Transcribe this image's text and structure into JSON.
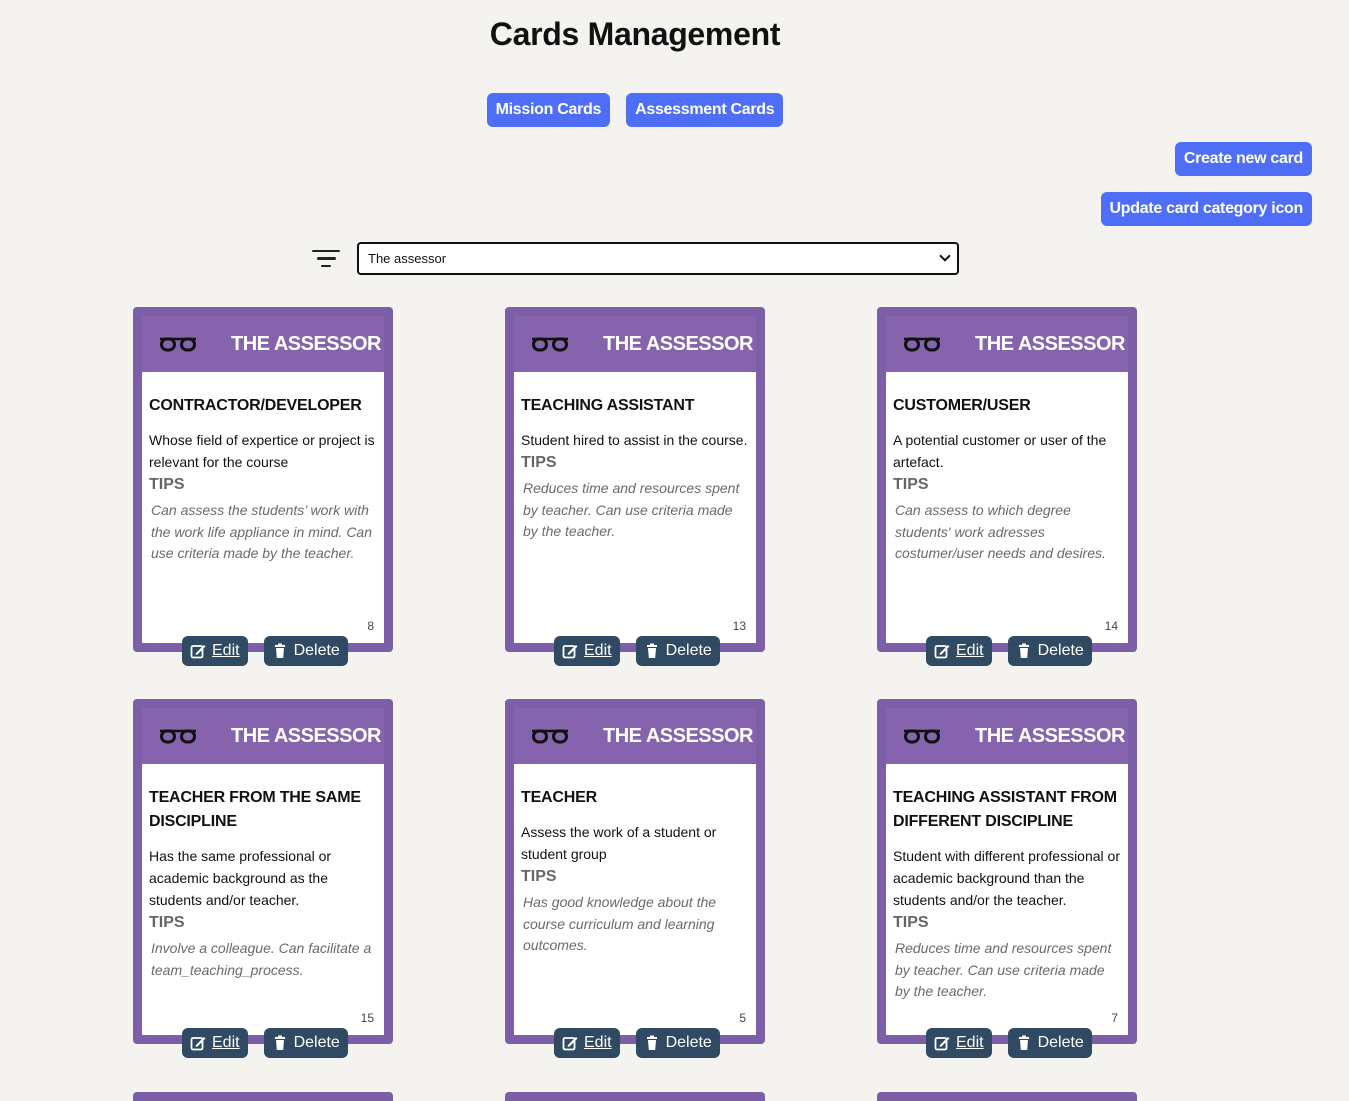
{
  "page": {
    "title": "Cards Management"
  },
  "tabs": [
    {
      "label": "Mission Cards"
    },
    {
      "label": "Assessment Cards"
    }
  ],
  "actions": {
    "create_label": "Create new card",
    "update_label": "Update card category icon"
  },
  "filter": {
    "selected": "The assessor"
  },
  "colors": {
    "accent_blue": "#4f6ef7",
    "card_purple": "#7d5fa8",
    "button_dark": "#2f4a62"
  },
  "cards": [
    {
      "category": "THE ASSESSOR",
      "icon": "glasses-icon",
      "title": "CONTRACTOR/DEVELOPER",
      "description": "Whose field of expertice or project is relevant for the course",
      "tips_label": "TIPS",
      "tips": "Can assess the students’ work with the work life appliance in mind. Can use criteria made by the teacher.",
      "number": "8",
      "edit_label": "Edit",
      "delete_label": "Delete"
    },
    {
      "category": "THE ASSESSOR",
      "icon": "glasses-icon",
      "title": "TEACHING ASSISTANT",
      "description": "Student hired to assist in the course.",
      "tips_label": "TIPS",
      "tips": "Reduces time and resources spent by teacher. Can use criteria made by the teacher.",
      "number": "13",
      "edit_label": "Edit",
      "delete_label": "Delete"
    },
    {
      "category": "THE ASSESSOR",
      "icon": "glasses-icon",
      "title": "CUSTOMER/USER",
      "description": "A potential customer or user of the artefact.",
      "tips_label": "TIPS",
      "tips": "Can assess to which degree students' work adresses costumer/user needs and desires.",
      "number": "14",
      "edit_label": "Edit",
      "delete_label": "Delete"
    },
    {
      "category": "THE ASSESSOR",
      "icon": "glasses-icon",
      "title": "TEACHER FROM THE SAME DISCIPLINE",
      "description": "Has the same professional or academic background as the students and/or teacher.",
      "tips_label": "TIPS",
      "tips": "Involve a colleague. Can facilitate a team_teaching_process.",
      "number": "15",
      "edit_label": "Edit",
      "delete_label": "Delete"
    },
    {
      "category": "THE ASSESSOR",
      "icon": "glasses-icon",
      "title": "TEACHER",
      "description": "Assess the work of a student or student group",
      "tips_label": "TIPS",
      "tips": "Has good knowledge about the course curriculum and learning outcomes.",
      "number": "5",
      "edit_label": "Edit",
      "delete_label": "Delete"
    },
    {
      "category": "THE ASSESSOR",
      "icon": "glasses-icon",
      "title": "TEACHING ASSISTANT FROM DIFFERENT DISCIPLINE",
      "description": "Student with different professional or academic background than the students and/or the teacher.",
      "tips_label": "TIPS",
      "tips": "Reduces time and resources spent by teacher. Can use criteria made by the teacher.",
      "number": "7",
      "edit_label": "Edit",
      "delete_label": "Delete"
    }
  ]
}
